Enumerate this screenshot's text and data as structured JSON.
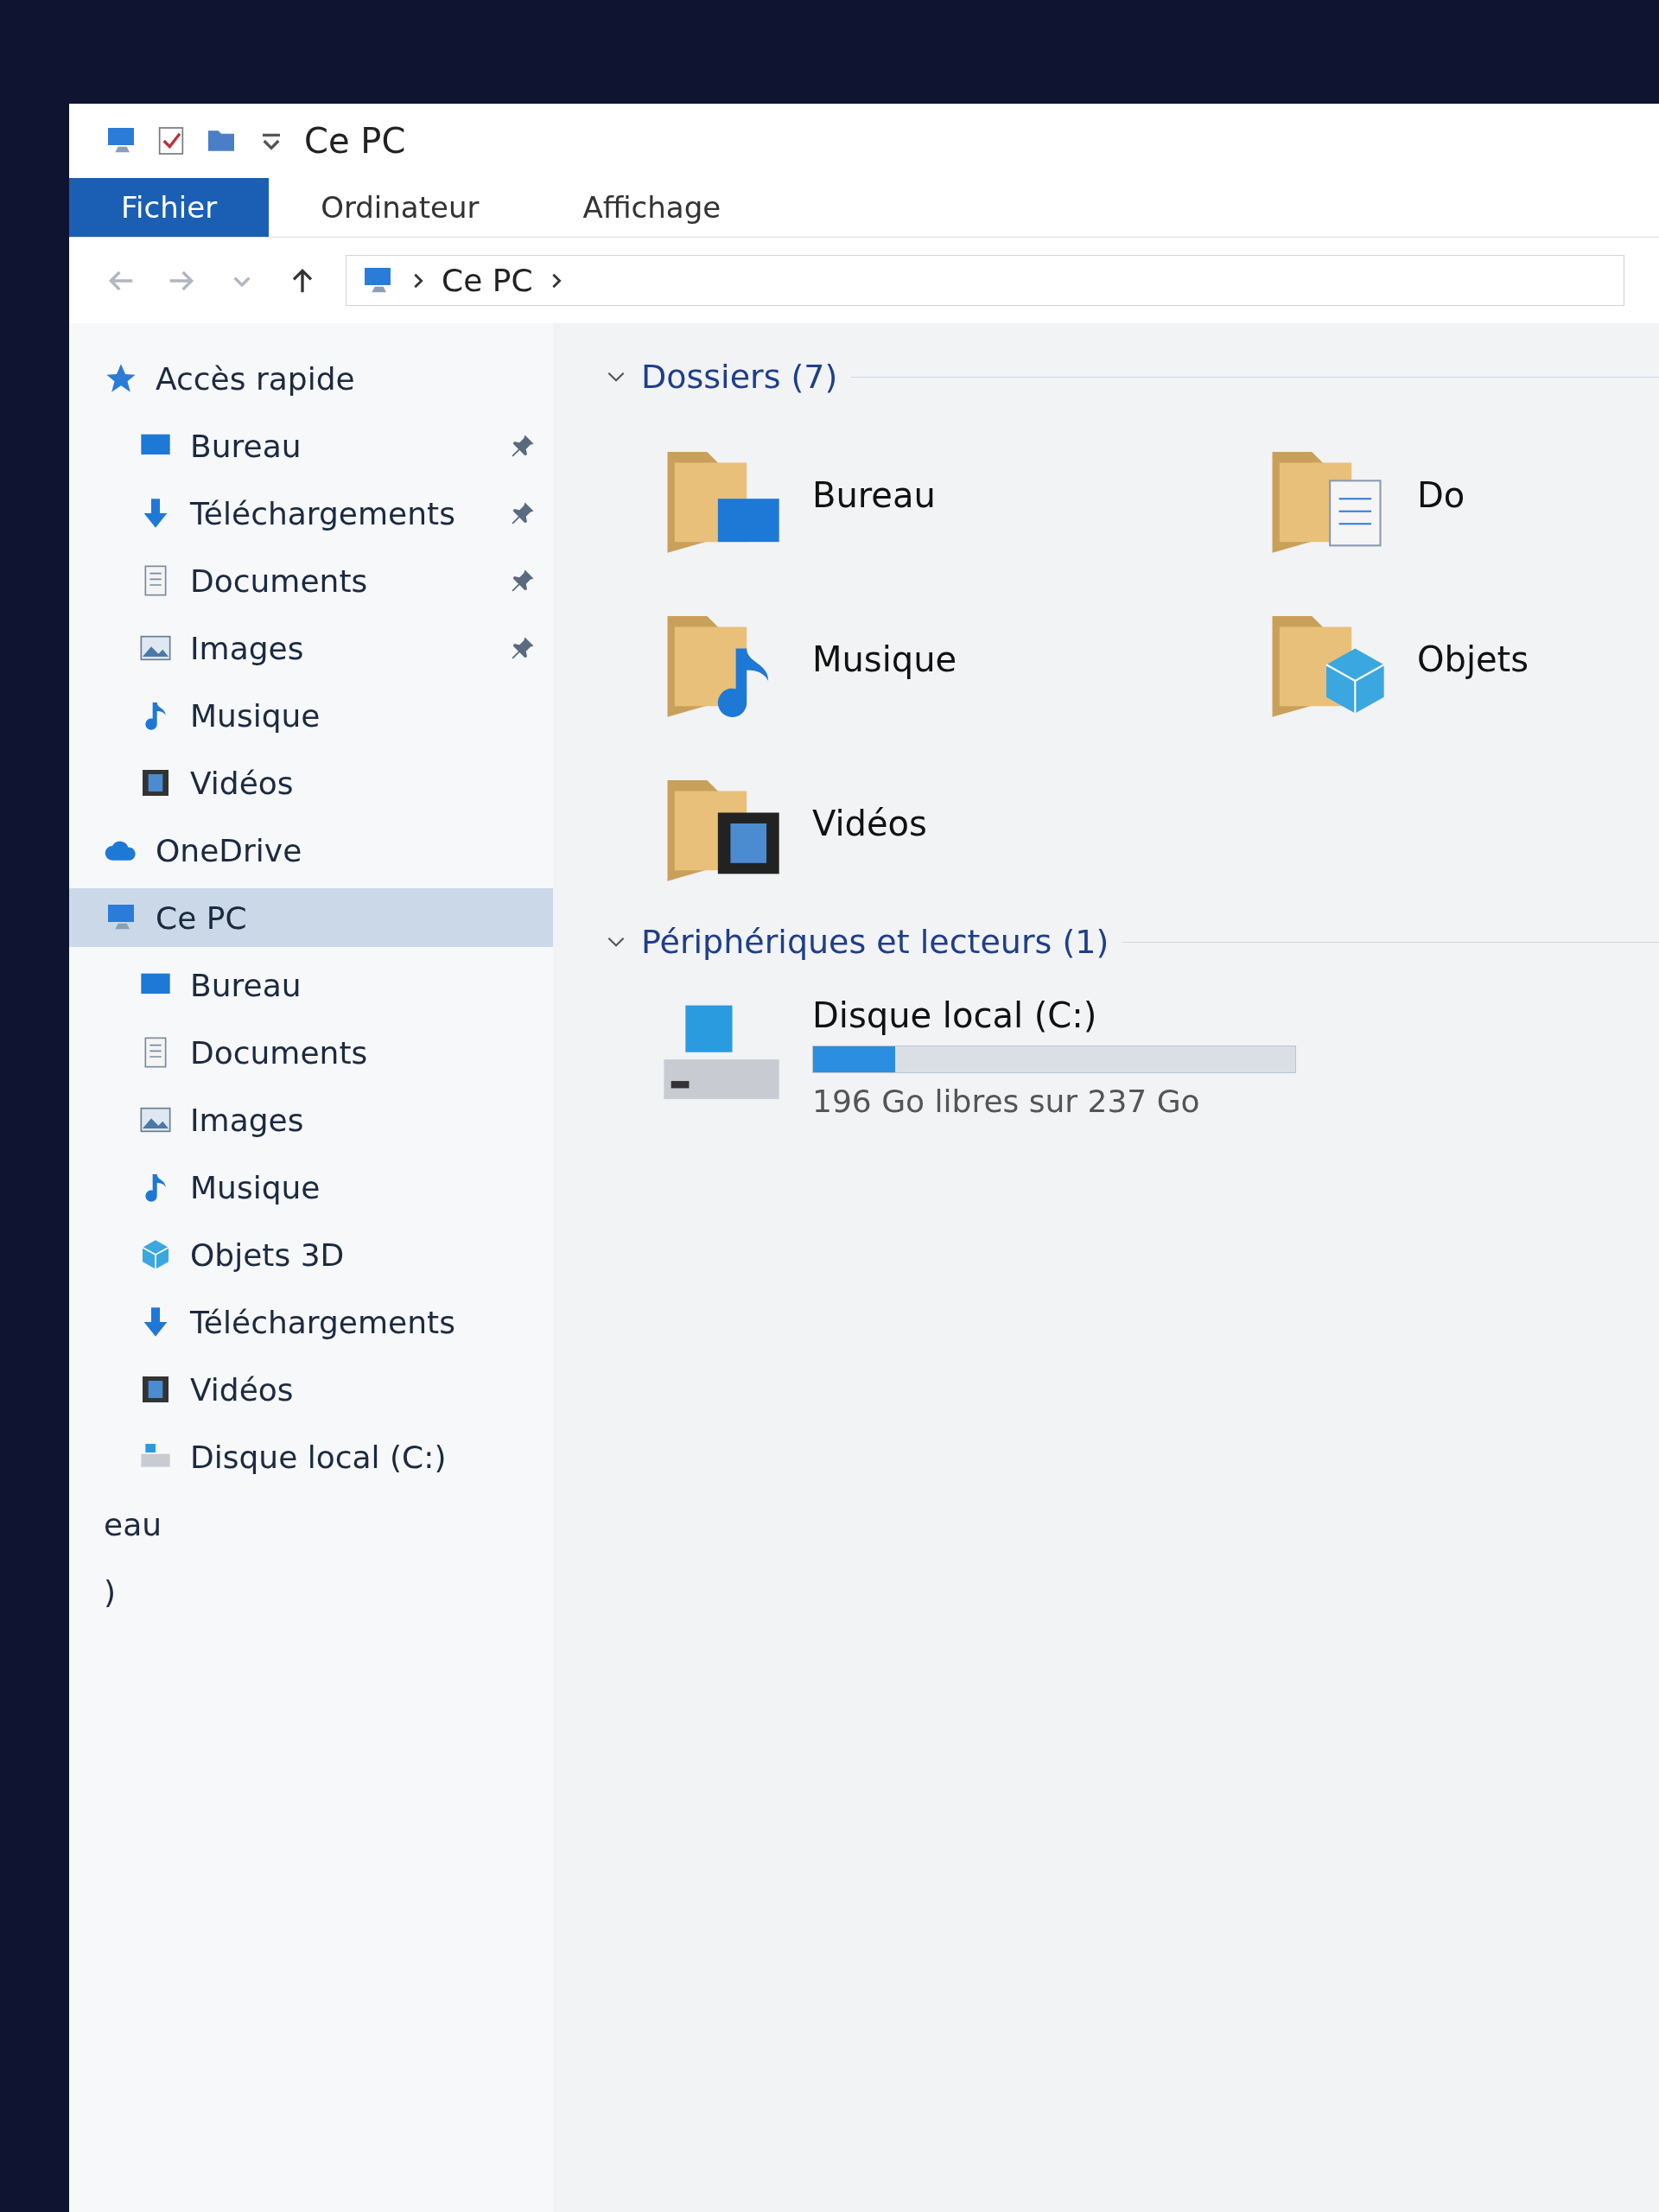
{
  "window": {
    "title": "Ce PC"
  },
  "ribbon": {
    "tabs": [
      {
        "label": "Fichier",
        "kind": "file",
        "selected": false
      },
      {
        "label": "Ordinateur",
        "kind": "tab",
        "selected": false
      },
      {
        "label": "Affichage",
        "kind": "tab",
        "selected": false
      }
    ]
  },
  "address": {
    "path": [
      "Ce PC"
    ]
  },
  "nav": [
    {
      "label": "Accès rapide",
      "kind": "star",
      "selected": false,
      "children": [
        {
          "label": "Bureau",
          "kind": "desktop",
          "pinned": true,
          "selected": false
        },
        {
          "label": "Téléchargements",
          "kind": "download",
          "pinned": true,
          "selected": false
        },
        {
          "label": "Documents",
          "kind": "document",
          "pinned": true,
          "selected": false
        },
        {
          "label": "Images",
          "kind": "image",
          "pinned": true,
          "selected": false
        },
        {
          "label": "Musique",
          "kind": "music",
          "pinned": false,
          "selected": false
        },
        {
          "label": "Vidéos",
          "kind": "video",
          "pinned": false,
          "selected": false
        }
      ]
    },
    {
      "label": "OneDrive",
      "kind": "cloud",
      "selected": false
    },
    {
      "label": "Ce PC",
      "kind": "pc",
      "selected": true,
      "children": [
        {
          "label": "Bureau",
          "kind": "desktop",
          "selected": false
        },
        {
          "label": "Documents",
          "kind": "document",
          "selected": false
        },
        {
          "label": "Images",
          "kind": "image",
          "selected": false
        },
        {
          "label": "Musique",
          "kind": "music",
          "selected": false
        },
        {
          "label": "Objets 3D",
          "kind": "cube",
          "selected": false
        },
        {
          "label": "Téléchargements",
          "kind": "download",
          "selected": false
        },
        {
          "label": "Vidéos",
          "kind": "video",
          "selected": false
        },
        {
          "label": "Disque local (C:)",
          "kind": "drive",
          "selected": false
        }
      ]
    },
    {
      "label": "eau",
      "kind": "cut",
      "selected": false
    },
    {
      "label": ")",
      "kind": "cut",
      "selected": false
    }
  ],
  "content": {
    "folders": {
      "title": "Dossiers (7)",
      "expanded": true,
      "items": [
        {
          "label": "Bureau",
          "kind": "desktop"
        },
        {
          "label": "Do",
          "kind": "document"
        },
        {
          "label": "Musique",
          "kind": "music"
        },
        {
          "label": "Objets",
          "kind": "cube"
        },
        {
          "label": "Vidéos",
          "kind": "video"
        }
      ]
    },
    "devices": {
      "title": "Périphériques et lecteurs (1)",
      "expanded": true,
      "drives": [
        {
          "label": "Disque local (C:)",
          "level": 0.17,
          "reading": "196 Go libres sur 237 Go"
        }
      ]
    }
  }
}
